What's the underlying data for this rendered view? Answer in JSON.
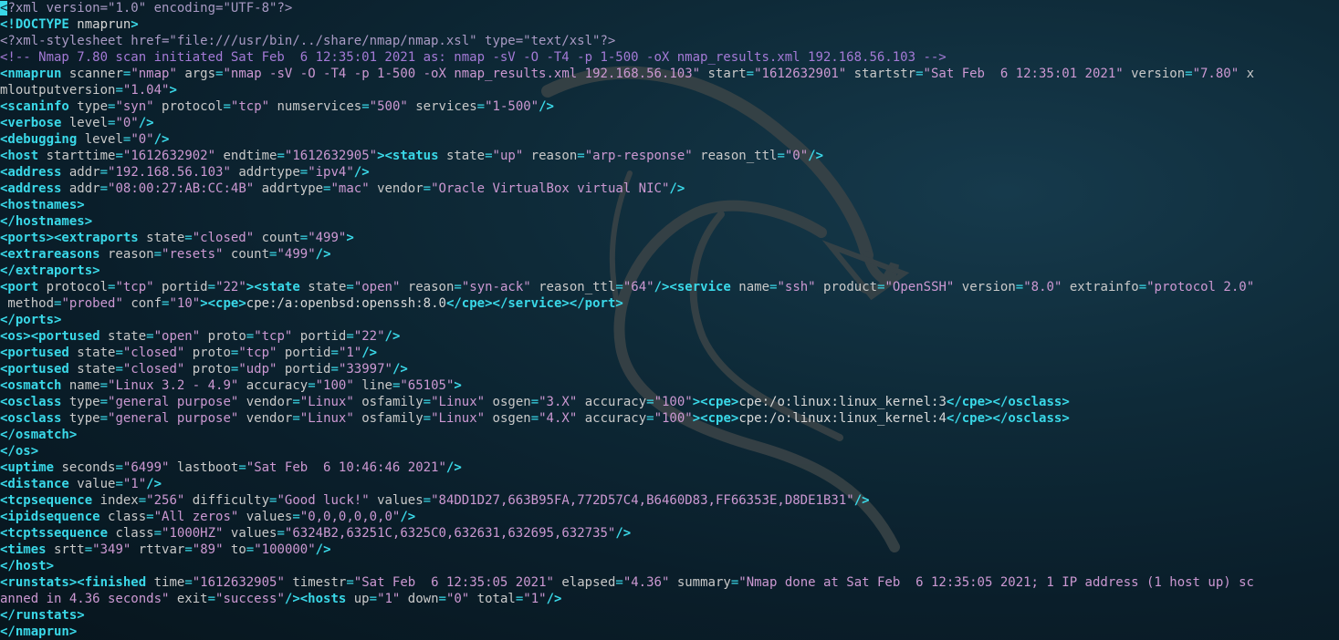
{
  "terminal": {
    "lines": [
      [
        [
          "cur",
          "<"
        ],
        [
          "pi",
          "?xml version=\"1.0\" encoding=\"UTF-8\"?>"
        ]
      ],
      [
        [
          "tag",
          "<!DOCTYPE"
        ],
        [
          "txt",
          " nmaprun"
        ],
        [
          "tag",
          ">"
        ]
      ],
      [
        [
          "pi",
          "<?xml-stylesheet href=\"file:///usr/bin/../share/nmap/nmap.xsl\" type=\"text/xsl\"?>"
        ]
      ],
      [
        [
          "cmt",
          "<!-- Nmap 7.80 scan initiated Sat Feb  6 12:35:01 2021 as: nmap -sV -O -T4 -p 1-500 -oX nmap_results.xml 192.168.56.103 -->"
        ]
      ],
      [
        [
          "tag",
          "<nmaprun"
        ],
        [
          "attr",
          " scanner"
        ],
        [
          "pun",
          "="
        ],
        [
          "val",
          "\"nmap\""
        ],
        [
          "attr",
          " args"
        ],
        [
          "pun",
          "="
        ],
        [
          "val",
          "\"nmap -sV -O -T4 -p 1-500 -oX nmap_results.xml 192.168.56.103\""
        ],
        [
          "attr",
          " start"
        ],
        [
          "pun",
          "="
        ],
        [
          "val",
          "\"1612632901\""
        ],
        [
          "attr",
          " startstr"
        ],
        [
          "pun",
          "="
        ],
        [
          "val",
          "\"Sat Feb  6 12:35:01 2021\""
        ],
        [
          "attr",
          " version"
        ],
        [
          "pun",
          "="
        ],
        [
          "val",
          "\"7.80\""
        ],
        [
          "attr",
          " x"
        ]
      ],
      [
        [
          "attr",
          "mloutputversion"
        ],
        [
          "pun",
          "="
        ],
        [
          "val",
          "\"1.04\""
        ],
        [
          "tag",
          ">"
        ]
      ],
      [
        [
          "tag",
          "<scaninfo"
        ],
        [
          "attr",
          " type"
        ],
        [
          "pun",
          "="
        ],
        [
          "val",
          "\"syn\""
        ],
        [
          "attr",
          " protocol"
        ],
        [
          "pun",
          "="
        ],
        [
          "val",
          "\"tcp\""
        ],
        [
          "attr",
          " numservices"
        ],
        [
          "pun",
          "="
        ],
        [
          "val",
          "\"500\""
        ],
        [
          "attr",
          " services"
        ],
        [
          "pun",
          "="
        ],
        [
          "val",
          "\"1-500\""
        ],
        [
          "tag",
          "/>"
        ]
      ],
      [
        [
          "tag",
          "<verbose"
        ],
        [
          "attr",
          " level"
        ],
        [
          "pun",
          "="
        ],
        [
          "val",
          "\"0\""
        ],
        [
          "tag",
          "/>"
        ]
      ],
      [
        [
          "tag",
          "<debugging"
        ],
        [
          "attr",
          " level"
        ],
        [
          "pun",
          "="
        ],
        [
          "val",
          "\"0\""
        ],
        [
          "tag",
          "/>"
        ]
      ],
      [
        [
          "tag",
          "<host"
        ],
        [
          "attr",
          " starttime"
        ],
        [
          "pun",
          "="
        ],
        [
          "val",
          "\"1612632902\""
        ],
        [
          "attr",
          " endtime"
        ],
        [
          "pun",
          "="
        ],
        [
          "val",
          "\"1612632905\""
        ],
        [
          "tag",
          "><status"
        ],
        [
          "attr",
          " state"
        ],
        [
          "pun",
          "="
        ],
        [
          "val",
          "\"up\""
        ],
        [
          "attr",
          " reason"
        ],
        [
          "pun",
          "="
        ],
        [
          "val",
          "\"arp-response\""
        ],
        [
          "attr",
          " reason_ttl"
        ],
        [
          "pun",
          "="
        ],
        [
          "val",
          "\"0\""
        ],
        [
          "tag",
          "/>"
        ]
      ],
      [
        [
          "tag",
          "<address"
        ],
        [
          "attr",
          " addr"
        ],
        [
          "pun",
          "="
        ],
        [
          "val",
          "\"192.168.56.103\""
        ],
        [
          "attr",
          " addrtype"
        ],
        [
          "pun",
          "="
        ],
        [
          "val",
          "\"ipv4\""
        ],
        [
          "tag",
          "/>"
        ]
      ],
      [
        [
          "tag",
          "<address"
        ],
        [
          "attr",
          " addr"
        ],
        [
          "pun",
          "="
        ],
        [
          "val",
          "\"08:00:27:AB:CC:4B\""
        ],
        [
          "attr",
          " addrtype"
        ],
        [
          "pun",
          "="
        ],
        [
          "val",
          "\"mac\""
        ],
        [
          "attr",
          " vendor"
        ],
        [
          "pun",
          "="
        ],
        [
          "val",
          "\"Oracle VirtualBox virtual NIC\""
        ],
        [
          "tag",
          "/>"
        ]
      ],
      [
        [
          "tag",
          "<hostnames>"
        ]
      ],
      [
        [
          "tag",
          "</hostnames>"
        ]
      ],
      [
        [
          "tag",
          "<ports><extraports"
        ],
        [
          "attr",
          " state"
        ],
        [
          "pun",
          "="
        ],
        [
          "val",
          "\"closed\""
        ],
        [
          "attr",
          " count"
        ],
        [
          "pun",
          "="
        ],
        [
          "val",
          "\"499\""
        ],
        [
          "tag",
          ">"
        ]
      ],
      [
        [
          "tag",
          "<extrareasons"
        ],
        [
          "attr",
          " reason"
        ],
        [
          "pun",
          "="
        ],
        [
          "val",
          "\"resets\""
        ],
        [
          "attr",
          " count"
        ],
        [
          "pun",
          "="
        ],
        [
          "val",
          "\"499\""
        ],
        [
          "tag",
          "/>"
        ]
      ],
      [
        [
          "tag",
          "</extraports>"
        ]
      ],
      [
        [
          "tag",
          "<port"
        ],
        [
          "attr",
          " protocol"
        ],
        [
          "pun",
          "="
        ],
        [
          "val",
          "\"tcp\""
        ],
        [
          "attr",
          " portid"
        ],
        [
          "pun",
          "="
        ],
        [
          "val",
          "\"22\""
        ],
        [
          "tag",
          "><state"
        ],
        [
          "attr",
          " state"
        ],
        [
          "pun",
          "="
        ],
        [
          "val",
          "\"open\""
        ],
        [
          "attr",
          " reason"
        ],
        [
          "pun",
          "="
        ],
        [
          "val",
          "\"syn-ack\""
        ],
        [
          "attr",
          " reason_ttl"
        ],
        [
          "pun",
          "="
        ],
        [
          "val",
          "\"64\""
        ],
        [
          "tag",
          "/><service"
        ],
        [
          "attr",
          " name"
        ],
        [
          "pun",
          "="
        ],
        [
          "val",
          "\"ssh\""
        ],
        [
          "attr",
          " product"
        ],
        [
          "pun",
          "="
        ],
        [
          "val",
          "\"OpenSSH\""
        ],
        [
          "attr",
          " version"
        ],
        [
          "pun",
          "="
        ],
        [
          "val",
          "\"8.0\""
        ],
        [
          "attr",
          " extrainfo"
        ],
        [
          "pun",
          "="
        ],
        [
          "val",
          "\"protocol 2.0\""
        ]
      ],
      [
        [
          "attr",
          " method"
        ],
        [
          "pun",
          "="
        ],
        [
          "val",
          "\"probed\""
        ],
        [
          "attr",
          " conf"
        ],
        [
          "pun",
          "="
        ],
        [
          "val",
          "\"10\""
        ],
        [
          "tag",
          "><cpe>"
        ],
        [
          "txt",
          "cpe:/a:openbsd:openssh:8.0"
        ],
        [
          "tag",
          "</cpe></service></port>"
        ]
      ],
      [
        [
          "tag",
          "</ports>"
        ]
      ],
      [
        [
          "tag",
          "<os><portused"
        ],
        [
          "attr",
          " state"
        ],
        [
          "pun",
          "="
        ],
        [
          "val",
          "\"open\""
        ],
        [
          "attr",
          " proto"
        ],
        [
          "pun",
          "="
        ],
        [
          "val",
          "\"tcp\""
        ],
        [
          "attr",
          " portid"
        ],
        [
          "pun",
          "="
        ],
        [
          "val",
          "\"22\""
        ],
        [
          "tag",
          "/>"
        ]
      ],
      [
        [
          "tag",
          "<portused"
        ],
        [
          "attr",
          " state"
        ],
        [
          "pun",
          "="
        ],
        [
          "val",
          "\"closed\""
        ],
        [
          "attr",
          " proto"
        ],
        [
          "pun",
          "="
        ],
        [
          "val",
          "\"tcp\""
        ],
        [
          "attr",
          " portid"
        ],
        [
          "pun",
          "="
        ],
        [
          "val",
          "\"1\""
        ],
        [
          "tag",
          "/>"
        ]
      ],
      [
        [
          "tag",
          "<portused"
        ],
        [
          "attr",
          " state"
        ],
        [
          "pun",
          "="
        ],
        [
          "val",
          "\"closed\""
        ],
        [
          "attr",
          " proto"
        ],
        [
          "pun",
          "="
        ],
        [
          "val",
          "\"udp\""
        ],
        [
          "attr",
          " portid"
        ],
        [
          "pun",
          "="
        ],
        [
          "val",
          "\"33997\""
        ],
        [
          "tag",
          "/>"
        ]
      ],
      [
        [
          "tag",
          "<osmatch"
        ],
        [
          "attr",
          " name"
        ],
        [
          "pun",
          "="
        ],
        [
          "val",
          "\"Linux 3.2 - 4.9\""
        ],
        [
          "attr",
          " accuracy"
        ],
        [
          "pun",
          "="
        ],
        [
          "val",
          "\"100\""
        ],
        [
          "attr",
          " line"
        ],
        [
          "pun",
          "="
        ],
        [
          "val",
          "\"65105\""
        ],
        [
          "tag",
          ">"
        ]
      ],
      [
        [
          "tag",
          "<osclass"
        ],
        [
          "attr",
          " type"
        ],
        [
          "pun",
          "="
        ],
        [
          "val",
          "\"general purpose\""
        ],
        [
          "attr",
          " vendor"
        ],
        [
          "pun",
          "="
        ],
        [
          "val",
          "\"Linux\""
        ],
        [
          "attr",
          " osfamily"
        ],
        [
          "pun",
          "="
        ],
        [
          "val",
          "\"Linux\""
        ],
        [
          "attr",
          " osgen"
        ],
        [
          "pun",
          "="
        ],
        [
          "val",
          "\"3.X\""
        ],
        [
          "attr",
          " accuracy"
        ],
        [
          "pun",
          "="
        ],
        [
          "val",
          "\"100\""
        ],
        [
          "tag",
          "><cpe>"
        ],
        [
          "txt",
          "cpe:/o:linux:linux_kernel:3"
        ],
        [
          "tag",
          "</cpe></osclass>"
        ]
      ],
      [
        [
          "tag",
          "<osclass"
        ],
        [
          "attr",
          " type"
        ],
        [
          "pun",
          "="
        ],
        [
          "val",
          "\"general purpose\""
        ],
        [
          "attr",
          " vendor"
        ],
        [
          "pun",
          "="
        ],
        [
          "val",
          "\"Linux\""
        ],
        [
          "attr",
          " osfamily"
        ],
        [
          "pun",
          "="
        ],
        [
          "val",
          "\"Linux\""
        ],
        [
          "attr",
          " osgen"
        ],
        [
          "pun",
          "="
        ],
        [
          "val",
          "\"4.X\""
        ],
        [
          "attr",
          " accuracy"
        ],
        [
          "pun",
          "="
        ],
        [
          "val",
          "\"100\""
        ],
        [
          "tag",
          "><cpe>"
        ],
        [
          "txt",
          "cpe:/o:linux:linux_kernel:4"
        ],
        [
          "tag",
          "</cpe></osclass>"
        ]
      ],
      [
        [
          "tag",
          "</osmatch>"
        ]
      ],
      [
        [
          "tag",
          "</os>"
        ]
      ],
      [
        [
          "tag",
          "<uptime"
        ],
        [
          "attr",
          " seconds"
        ],
        [
          "pun",
          "="
        ],
        [
          "val",
          "\"6499\""
        ],
        [
          "attr",
          " lastboot"
        ],
        [
          "pun",
          "="
        ],
        [
          "val",
          "\"Sat Feb  6 10:46:46 2021\""
        ],
        [
          "tag",
          "/>"
        ]
      ],
      [
        [
          "tag",
          "<distance"
        ],
        [
          "attr",
          " value"
        ],
        [
          "pun",
          "="
        ],
        [
          "val",
          "\"1\""
        ],
        [
          "tag",
          "/>"
        ]
      ],
      [
        [
          "tag",
          "<tcpsequence"
        ],
        [
          "attr",
          " index"
        ],
        [
          "pun",
          "="
        ],
        [
          "val",
          "\"256\""
        ],
        [
          "attr",
          " difficulty"
        ],
        [
          "pun",
          "="
        ],
        [
          "val",
          "\"Good luck!\""
        ],
        [
          "attr",
          " values"
        ],
        [
          "pun",
          "="
        ],
        [
          "val",
          "\"84DD1D27,663B95FA,772D57C4,B6460D83,FF66353E,D8DE1B31\""
        ],
        [
          "tag",
          "/>"
        ]
      ],
      [
        [
          "tag",
          "<ipidsequence"
        ],
        [
          "attr",
          " class"
        ],
        [
          "pun",
          "="
        ],
        [
          "val",
          "\"All zeros\""
        ],
        [
          "attr",
          " values"
        ],
        [
          "pun",
          "="
        ],
        [
          "val",
          "\"0,0,0,0,0,0\""
        ],
        [
          "tag",
          "/>"
        ]
      ],
      [
        [
          "tag",
          "<tcptssequence"
        ],
        [
          "attr",
          " class"
        ],
        [
          "pun",
          "="
        ],
        [
          "val",
          "\"1000HZ\""
        ],
        [
          "attr",
          " values"
        ],
        [
          "pun",
          "="
        ],
        [
          "val",
          "\"6324B2,63251C,6325C0,632631,632695,632735\""
        ],
        [
          "tag",
          "/>"
        ]
      ],
      [
        [
          "tag",
          "<times"
        ],
        [
          "attr",
          " srtt"
        ],
        [
          "pun",
          "="
        ],
        [
          "val",
          "\"349\""
        ],
        [
          "attr",
          " rttvar"
        ],
        [
          "pun",
          "="
        ],
        [
          "val",
          "\"89\""
        ],
        [
          "attr",
          " to"
        ],
        [
          "pun",
          "="
        ],
        [
          "val",
          "\"100000\""
        ],
        [
          "tag",
          "/>"
        ]
      ],
      [
        [
          "tag",
          "</host>"
        ]
      ],
      [
        [
          "tag",
          "<runstats><finished"
        ],
        [
          "attr",
          " time"
        ],
        [
          "pun",
          "="
        ],
        [
          "val",
          "\"1612632905\""
        ],
        [
          "attr",
          " timestr"
        ],
        [
          "pun",
          "="
        ],
        [
          "val",
          "\"Sat Feb  6 12:35:05 2021\""
        ],
        [
          "attr",
          " elapsed"
        ],
        [
          "pun",
          "="
        ],
        [
          "val",
          "\"4.36\""
        ],
        [
          "attr",
          " summary"
        ],
        [
          "pun",
          "="
        ],
        [
          "val",
          "\"Nmap done at Sat Feb  6 12:35:05 2021; 1 IP address (1 host up) sc"
        ]
      ],
      [
        [
          "val",
          "anned in 4.36 seconds\""
        ],
        [
          "attr",
          " exit"
        ],
        [
          "pun",
          "="
        ],
        [
          "val",
          "\"success\""
        ],
        [
          "tag",
          "/><hosts"
        ],
        [
          "attr",
          " up"
        ],
        [
          "pun",
          "="
        ],
        [
          "val",
          "\"1\""
        ],
        [
          "attr",
          " down"
        ],
        [
          "pun",
          "="
        ],
        [
          "val",
          "\"0\""
        ],
        [
          "attr",
          " total"
        ],
        [
          "pun",
          "="
        ],
        [
          "val",
          "\"1\""
        ],
        [
          "tag",
          "/>"
        ]
      ],
      [
        [
          "tag",
          "</runstats>"
        ]
      ],
      [
        [
          "tag",
          "</nmaprun>"
        ]
      ]
    ]
  },
  "wallpaper": {
    "icon": "kali-dragon-icon"
  },
  "colors": {
    "background": "#0a1e2a",
    "tag": "#3ad8e8",
    "attribute": "#c9c9c9",
    "value": "#cc98d2",
    "text": "#d8d8d8",
    "comment": "#a47ad6",
    "processing_instruction": "#a99ac4",
    "cursor": "#3ad8e8"
  }
}
